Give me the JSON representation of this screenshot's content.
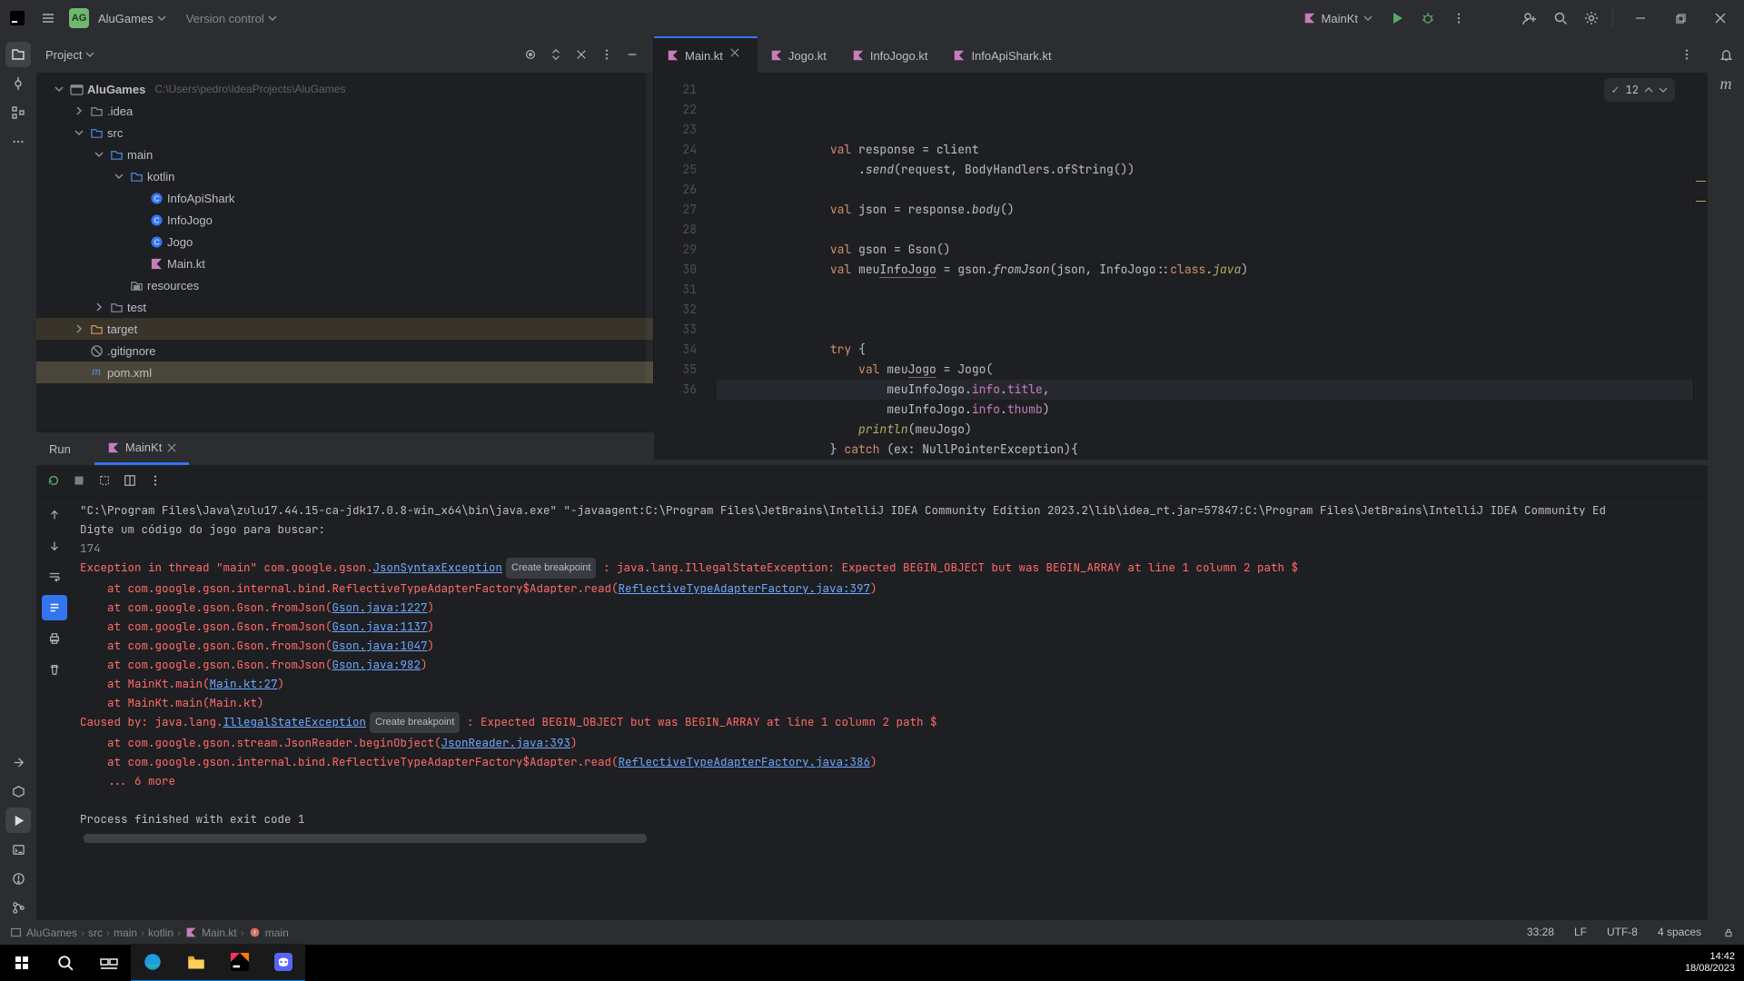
{
  "titlebar": {
    "project_badge": "AG",
    "project_name": "AluGames",
    "version_control": "Version control",
    "run_config": "MainKt"
  },
  "project_panel": {
    "title": "Project",
    "tree": {
      "root": {
        "name": "AluGames",
        "hint": "C:\\Users\\pedro\\IdeaProjects\\AluGames"
      },
      "idea": ".idea",
      "src": "src",
      "main": "main",
      "kotlin": "kotlin",
      "infoApiShark": "InfoApiShark",
      "infoJogo": "InfoJogo",
      "jogo": "Jogo",
      "mainkt": "Main.kt",
      "resources": "resources",
      "test": "test",
      "target": "target",
      "gitignore": ".gitignore",
      "pom": "pom.xml"
    }
  },
  "editor": {
    "tabs": [
      {
        "name": "Main.kt",
        "active": true
      },
      {
        "name": "Jogo.kt"
      },
      {
        "name": "InfoJogo.kt"
      },
      {
        "name": "InfoApiShark.kt"
      }
    ],
    "first_line_no": 21,
    "inspections": "12",
    "code_lines": [
      {
        "n": 21,
        "html": "                <span class='kw'>val</span> response = client"
      },
      {
        "n": 22,
        "html": "                    .<span class='fn'>send</span>(request, BodyHandlers.ofString())"
      },
      {
        "n": 23,
        "html": ""
      },
      {
        "n": 24,
        "html": "                <span class='kw'>val</span> json = response.<span class='fn'>body</span>()"
      },
      {
        "n": 25,
        "html": ""
      },
      {
        "n": 26,
        "html": "                <span class='kw'>val</span> gson = Gson()"
      },
      {
        "n": 27,
        "html": "                <span class='kw'>val</span> meu<span class='under'>InfoJogo</span> = gson.<span class='fn'>fromJson</span>(json, InfoJogo::<span class='kw'>class</span>.<span class='ital'>java</span>)"
      },
      {
        "n": 28,
        "html": ""
      },
      {
        "n": 29,
        "html": ""
      },
      {
        "n": 30,
        "html": ""
      },
      {
        "n": 31,
        "html": "                <span class='kw'>try</span> {"
      },
      {
        "n": 32,
        "html": "                    <span class='kw'>val</span> meu<span class='under'>Jogo</span> = Jogo("
      },
      {
        "n": 33,
        "html": "                        meuInfoJogo.<span class='field'>info</span>.<span class='field'>title</span>,",
        "cur": true
      },
      {
        "n": 34,
        "html": "                        meuInfoJogo.<span class='field'>info</span>.<span class='field'>thumb</span>)"
      },
      {
        "n": 35,
        "html": "                    <span class='ital'>println</span>(meuJogo)"
      },
      {
        "n": 36,
        "html": "                } <span class='kw'>catch</span> (ex: NullPointerException){"
      }
    ]
  },
  "run": {
    "title": "Run",
    "config": "MainKt",
    "lines": [
      {
        "cls": "c-w",
        "t": "\"C:\\Program Files\\Java\\zulu17.44.15-ca-jdk17.0.8-win_x64\\bin\\java.exe\" \"-javaagent:C:\\Program Files\\JetBrains\\IntelliJ IDEA Community Edition 2023.2\\lib\\idea_rt.jar=57847:C:\\Program Files\\JetBrains\\IntelliJ IDEA Community Ed"
      },
      {
        "cls": "c-w",
        "t": "Digte um código do jogo para buscar:"
      },
      {
        "cls": "c-g",
        "t": "174"
      },
      {
        "mixed": [
          {
            "cls": "c-r",
            "t": "Exception in thread \"main\" com.google.gson."
          },
          {
            "cls": "c-l",
            "t": "JsonSyntaxException"
          },
          {
            "badge": "Create breakpoint"
          },
          {
            "cls": "c-r",
            "t": " : java.lang.IllegalStateException: Expected BEGIN_OBJECT but was BEGIN_ARRAY at line 1 column 2 path $"
          }
        ]
      },
      {
        "mixed": [
          {
            "cls": "c-r",
            "t": "    at com.google.gson.internal.bind.ReflectiveTypeAdapterFactory$Adapter.read("
          },
          {
            "cls": "c-l",
            "t": "ReflectiveTypeAdapterFactory.java:397"
          },
          {
            "cls": "c-r",
            "t": ")"
          }
        ]
      },
      {
        "mixed": [
          {
            "cls": "c-r",
            "t": "    at com.google.gson.Gson.fromJson("
          },
          {
            "cls": "c-l",
            "t": "Gson.java:1227"
          },
          {
            "cls": "c-r",
            "t": ")"
          }
        ]
      },
      {
        "mixed": [
          {
            "cls": "c-r",
            "t": "    at com.google.gson.Gson.fromJson("
          },
          {
            "cls": "c-l",
            "t": "Gson.java:1137"
          },
          {
            "cls": "c-r",
            "t": ")"
          }
        ]
      },
      {
        "mixed": [
          {
            "cls": "c-r",
            "t": "    at com.google.gson.Gson.fromJson("
          },
          {
            "cls": "c-l",
            "t": "Gson.java:1047"
          },
          {
            "cls": "c-r",
            "t": ")"
          }
        ]
      },
      {
        "mixed": [
          {
            "cls": "c-r",
            "t": "    at com.google.gson.Gson.fromJson("
          },
          {
            "cls": "c-l",
            "t": "Gson.java:982"
          },
          {
            "cls": "c-r",
            "t": ")"
          }
        ]
      },
      {
        "mixed": [
          {
            "cls": "c-r",
            "t": "    at MainKt.main("
          },
          {
            "cls": "c-l",
            "t": "Main.kt:27"
          },
          {
            "cls": "c-r",
            "t": ")"
          }
        ]
      },
      {
        "cls": "c-r",
        "t": "    at MainKt.main(Main.kt)"
      },
      {
        "mixed": [
          {
            "cls": "c-r",
            "t": "Caused by: java.lang."
          },
          {
            "cls": "c-l",
            "t": "IllegalStateException"
          },
          {
            "badge": "Create breakpoint"
          },
          {
            "cls": "c-r",
            "t": " : Expected BEGIN_OBJECT but was BEGIN_ARRAY at line 1 column 2 path $"
          }
        ]
      },
      {
        "mixed": [
          {
            "cls": "c-r",
            "t": "    at com.google.gson.stream.JsonReader.beginObject("
          },
          {
            "cls": "c-l",
            "t": "JsonReader.java:393"
          },
          {
            "cls": "c-r",
            "t": ")"
          }
        ]
      },
      {
        "mixed": [
          {
            "cls": "c-r",
            "t": "    at com.google.gson.internal.bind.ReflectiveTypeAdapterFactory$Adapter.read("
          },
          {
            "cls": "c-l",
            "t": "ReflectiveTypeAdapterFactory.java:386"
          },
          {
            "cls": "c-r",
            "t": ")"
          }
        ]
      },
      {
        "cls": "c-r",
        "t": "    ... 6 more"
      },
      {
        "cls": "c-w",
        "t": ""
      },
      {
        "cls": "c-w",
        "t": "Process finished with exit code 1"
      }
    ]
  },
  "status": {
    "crumbs": [
      "AluGames",
      "src",
      "main",
      "kotlin",
      "Main.kt",
      "main"
    ],
    "pos": "33:28",
    "eol": "LF",
    "enc": "UTF-8",
    "indent": "4 spaces"
  },
  "taskbar": {
    "time": "14:42",
    "date": "18/08/2023"
  }
}
